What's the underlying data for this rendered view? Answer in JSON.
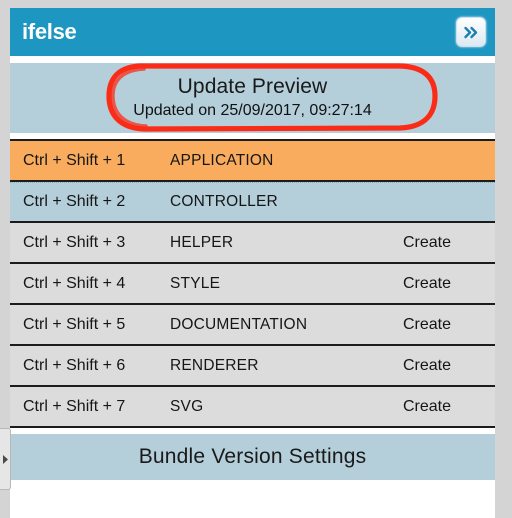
{
  "window": {
    "brand": "ifelse",
    "expand_icon": "double-chevron-right-icon"
  },
  "preview": {
    "title": "Update Preview",
    "subtitle": "Updated on 25/09/2017, 09:27:14",
    "annotation_color": "#fb2c17",
    "annotation_shape": "hand-drawn-rounded-rectangle"
  },
  "list": {
    "rows": [
      {
        "shortcut": "Ctrl + Shift + 1",
        "name": "APPLICATION",
        "action": "",
        "state": "active"
      },
      {
        "shortcut": "Ctrl + Shift + 2",
        "name": "CONTROLLER",
        "action": "",
        "state": "current"
      },
      {
        "shortcut": "Ctrl + Shift + 3",
        "name": "HELPER",
        "action": "Create",
        "state": "normal"
      },
      {
        "shortcut": "Ctrl + Shift + 4",
        "name": "STYLE",
        "action": "Create",
        "state": "normal"
      },
      {
        "shortcut": "Ctrl + Shift + 5",
        "name": "DOCUMENTATION",
        "action": "Create",
        "state": "normal"
      },
      {
        "shortcut": "Ctrl + Shift + 6",
        "name": "RENDERER",
        "action": "Create",
        "state": "normal"
      },
      {
        "shortcut": "Ctrl + Shift + 7",
        "name": "SVG",
        "action": "Create",
        "state": "normal"
      }
    ]
  },
  "footer": {
    "label": "Bundle Version Settings"
  },
  "pull_tab": {
    "icon": "triangle-right-icon"
  },
  "colors": {
    "header_teal": "#1d96c2",
    "band_blue": "#b4ceda",
    "row_active_orange": "#f9ac5d",
    "row_default_gray": "#dcdcdc",
    "annotation_red": "#fb2c17",
    "page_gutter_gray": "#d4d4d4"
  }
}
